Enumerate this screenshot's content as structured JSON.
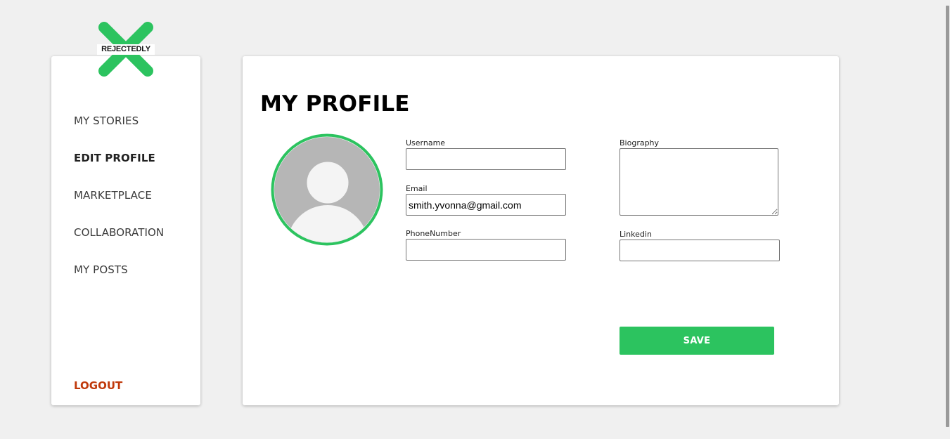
{
  "brand": {
    "name": "REJECTEDLY",
    "accent_color": "#2cc35f"
  },
  "sidebar": {
    "items": [
      {
        "label": "MY STORIES",
        "active": false
      },
      {
        "label": "EDIT PROFILE",
        "active": true
      },
      {
        "label": "MARKETPLACE",
        "active": false
      },
      {
        "label": "COLLABORATION",
        "active": false
      },
      {
        "label": "MY POSTS",
        "active": false
      }
    ],
    "logout_label": "LOGOUT",
    "logout_color": "#c0390b"
  },
  "profile": {
    "title": "MY PROFILE",
    "avatar_icon": "user-avatar-icon",
    "fields": {
      "username": {
        "label": "Username",
        "value": ""
      },
      "email": {
        "label": "Email",
        "value": "smith.yvonna@gmail.com"
      },
      "phone": {
        "label": "PhoneNumber",
        "value": ""
      },
      "biography": {
        "label": "Biography",
        "value": ""
      },
      "linkedin": {
        "label": "Linkedin",
        "value": ""
      }
    },
    "save_label": "SAVE",
    "save_color": "#2cc35f"
  }
}
